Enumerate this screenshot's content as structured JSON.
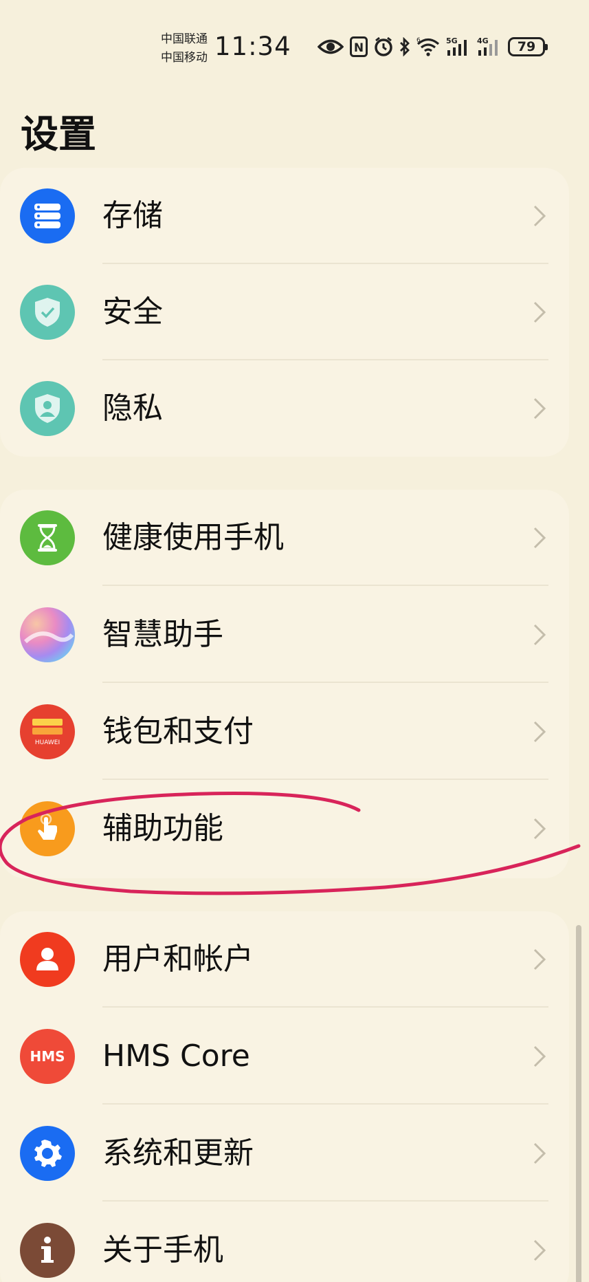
{
  "status_bar": {
    "carrier_1": "中国联通",
    "carrier_2": "中国移动",
    "time": "11:34",
    "nfc_label": "N",
    "wifi_sup": "6",
    "sim1_net": "5G",
    "sim2_net": "4G",
    "battery": "79",
    "icons": [
      "eye-icon",
      "nfc-icon",
      "alarm-icon",
      "bluetooth-icon",
      "wifi-icon",
      "signal-icon",
      "signal-icon",
      "battery-icon"
    ]
  },
  "page": {
    "title": "设置"
  },
  "groups": [
    {
      "items": [
        {
          "label": "存储",
          "icon": "storage-icon",
          "color": "#1a6cf2"
        },
        {
          "label": "安全",
          "icon": "shield-icon",
          "color": "#5ec5b2"
        },
        {
          "label": "隐私",
          "icon": "privacy-icon",
          "color": "#5ec5b2"
        }
      ]
    },
    {
      "items": [
        {
          "label": "健康使用手机",
          "icon": "hourglass-icon",
          "color": "#5dbb3f"
        },
        {
          "label": "智慧助手",
          "icon": "assistant-icon",
          "color": "#e38bc0"
        },
        {
          "label": "钱包和支付",
          "icon": "wallet-icon",
          "color": "#e6402f",
          "badge": "HUAWEI"
        },
        {
          "label": "辅助功能",
          "icon": "hand-icon",
          "color": "#f89b1d"
        }
      ]
    },
    {
      "items": [
        {
          "label": "用户和帐户",
          "icon": "user-icon",
          "color": "#f03b1f"
        },
        {
          "label": "HMS Core",
          "icon": "hms-icon",
          "color": "#ef4a38",
          "badge": "HMS"
        },
        {
          "label": "系统和更新",
          "icon": "gear-icon",
          "color": "#1a6cf2"
        },
        {
          "label": "关于手机",
          "icon": "info-icon",
          "color": "#7b4a36"
        }
      ]
    }
  ],
  "annotation_color": "#d8245a"
}
